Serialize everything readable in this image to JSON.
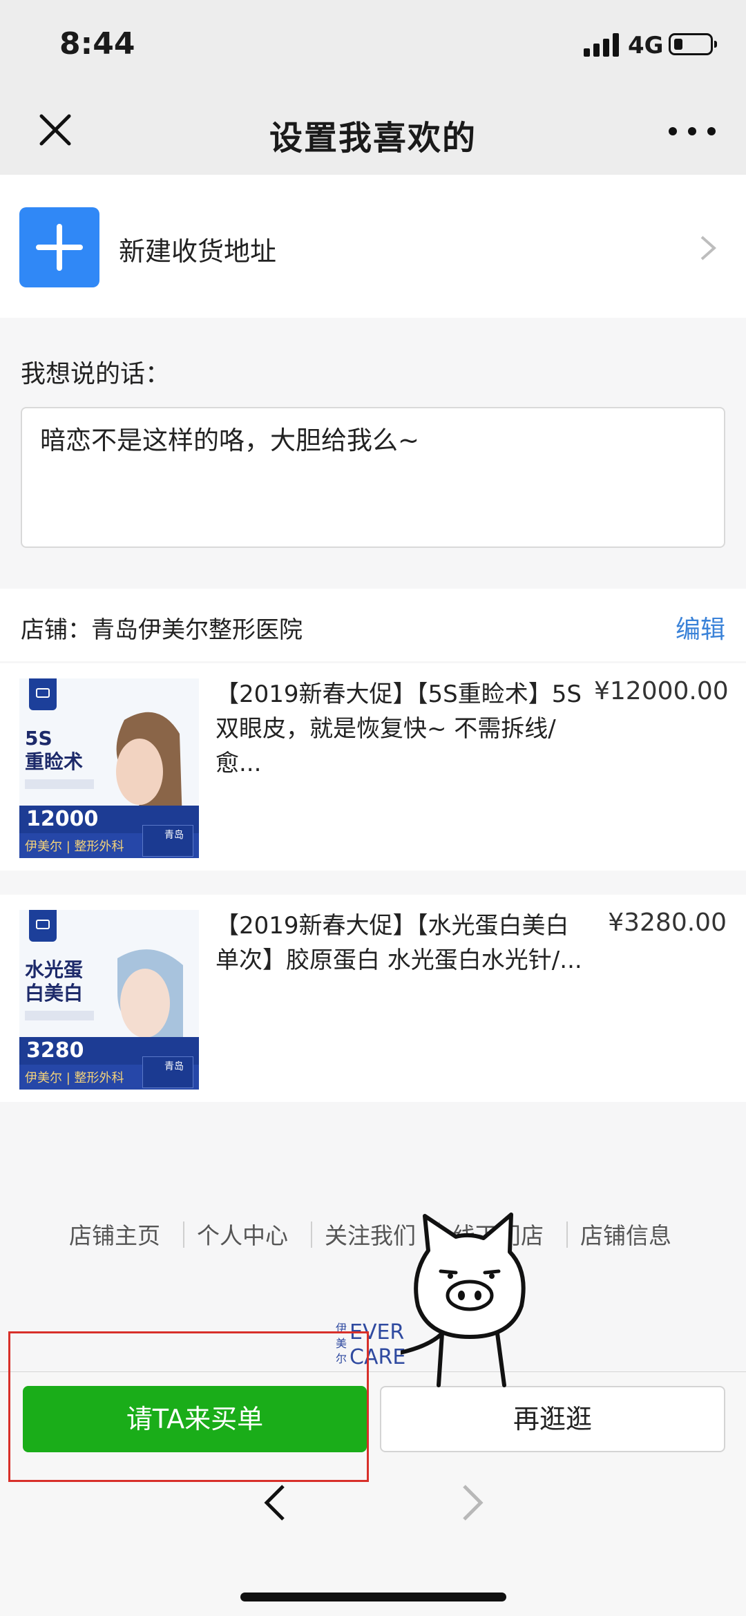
{
  "status_bar": {
    "time": "8:44",
    "network": "4G",
    "battery_level": 0.2
  },
  "nav": {
    "title": "设置我喜欢的",
    "close_icon": "close-icon",
    "more_icon": "more-icon"
  },
  "address": {
    "label": "新建收货地址",
    "icon": "plus-icon"
  },
  "message": {
    "title": "我想说的话：",
    "value": "暗恋不是这样的咯，大胆给我么~"
  },
  "store": {
    "label": "店铺：青岛伊美尔整形医院",
    "edit": "编辑"
  },
  "products": [
    {
      "title": "【2019新春大促】【5S重睑术】5S双眼皮，就是恢复快~ 不需拆线/愈...",
      "price": "¥12000.00",
      "thumb": {
        "line1": "5S",
        "line2": "重睑术",
        "price": "12000",
        "brand": "伊美尔 | 整形外科",
        "city": "青岛"
      }
    },
    {
      "title": "【2019新春大促】【水光蛋白美白单次】胶原蛋白 水光蛋白水光针/...",
      "price": "¥3280.00",
      "thumb": {
        "line1": "水光蛋",
        "line2": "白美白",
        "price": "3280",
        "brand": "伊美尔 | 整形外科",
        "city": "青岛"
      }
    }
  ],
  "footer_links": [
    "店铺主页",
    "个人中心",
    "关注我们",
    "线下门店",
    "店铺信息"
  ],
  "logo": {
    "side": "伊美尔",
    "line1": "EVER",
    "line2": "CARE"
  },
  "actions": {
    "pay": "请TA来买单",
    "browse": "再逛逛"
  },
  "colors": {
    "primary_green": "#1aad19",
    "link_blue": "#3a82d8",
    "plus_blue": "#3088f6",
    "highlight_red": "#d8302a"
  }
}
